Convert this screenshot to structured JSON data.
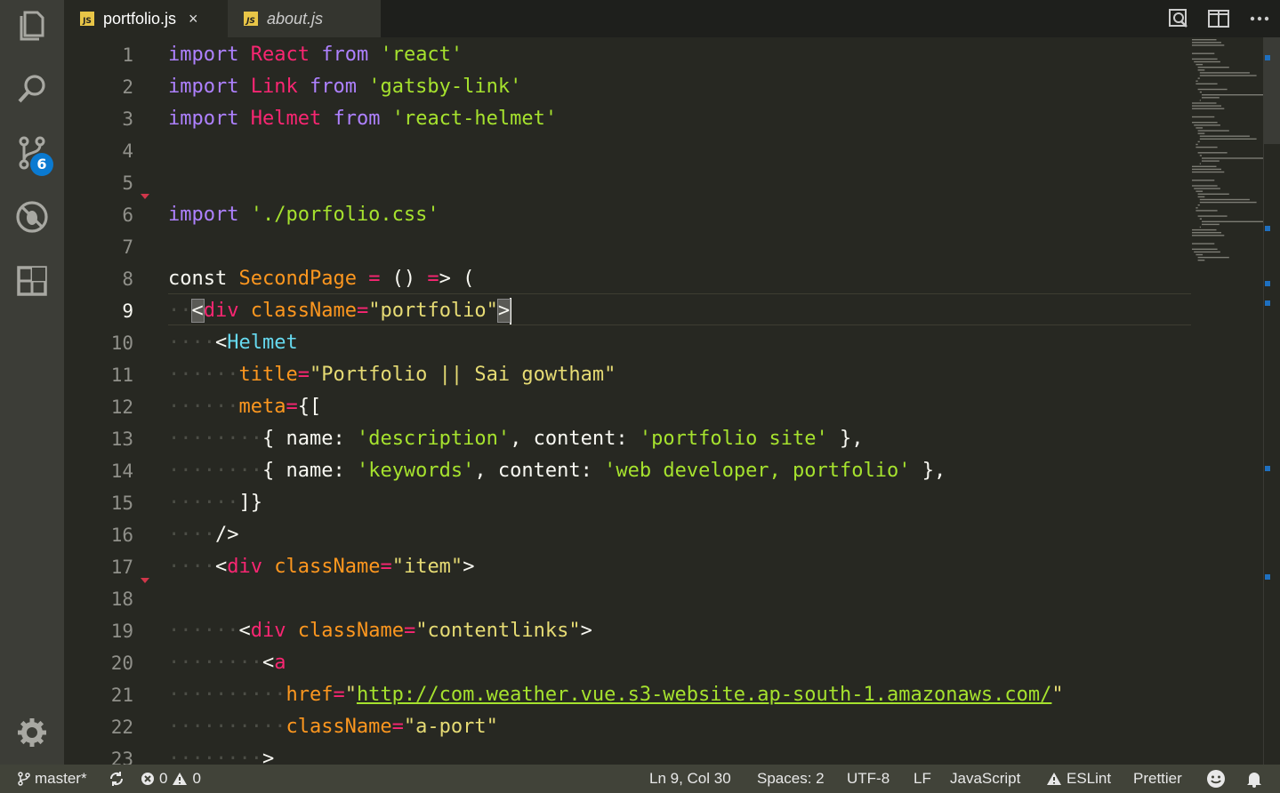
{
  "tabs": [
    {
      "label": "portfolio.js",
      "active": true,
      "icon": "javascript-file-icon",
      "close": "×"
    },
    {
      "label": "about.js",
      "active": false,
      "icon": "javascript-file-icon"
    }
  ],
  "activity_bar": {
    "items": [
      "explorer-icon",
      "search-icon",
      "source-control-icon",
      "debug-icon",
      "extensions-icon"
    ],
    "source_control_badge": "6",
    "bottom": "gear-icon"
  },
  "editor": {
    "language": "javascript",
    "current_line": 9,
    "line_numbers": [
      "1",
      "2",
      "3",
      "4",
      "5",
      "6",
      "7",
      "8",
      "9",
      "10",
      "11",
      "12",
      "13",
      "14",
      "15",
      "16",
      "17",
      "18",
      "19",
      "20",
      "21",
      "22",
      "23"
    ],
    "lines": [
      "import React from 'react'",
      "import Link from 'gatsby-link'",
      "import Helmet from 'react-helmet'",
      "",
      "",
      "import './porfolio.css'",
      "",
      "const SecondPage = () => (",
      "  <div className=\"portfolio\">",
      "    <Helmet",
      "      title=\"Portfolio || Sai gowtham\"",
      "      meta={[",
      "        { name: 'description', content: 'portfolio site' },",
      "        { name: 'keywords', content: 'web developer, portfolio' },",
      "      ]}",
      "    />",
      "    <div className=\"item\">",
      "",
      "      <div className=\"contentlinks\">",
      "        <a",
      "          href=\"http://com.weather.vue.s3-website.ap-south-1.amazonaws.com/\"",
      "          className=\"a-port\"",
      "        >"
    ]
  },
  "status_bar": {
    "branch": "master*",
    "errors": "0",
    "warnings": "0",
    "position": "Ln 9, Col 30",
    "indent": "Spaces: 2",
    "encoding": "UTF-8",
    "eol": "LF",
    "language": "JavaScript",
    "eslint": "ESLint",
    "prettier": "Prettier"
  },
  "colors": {
    "editor_bg": "#272822",
    "keyword": "#ae81ff",
    "identifier": "#f92672",
    "string": "#e6db74",
    "attribute": "#fd971f",
    "component": "#66d9ef",
    "status_bg": "#414339",
    "badge": "#0a7ad1"
  }
}
